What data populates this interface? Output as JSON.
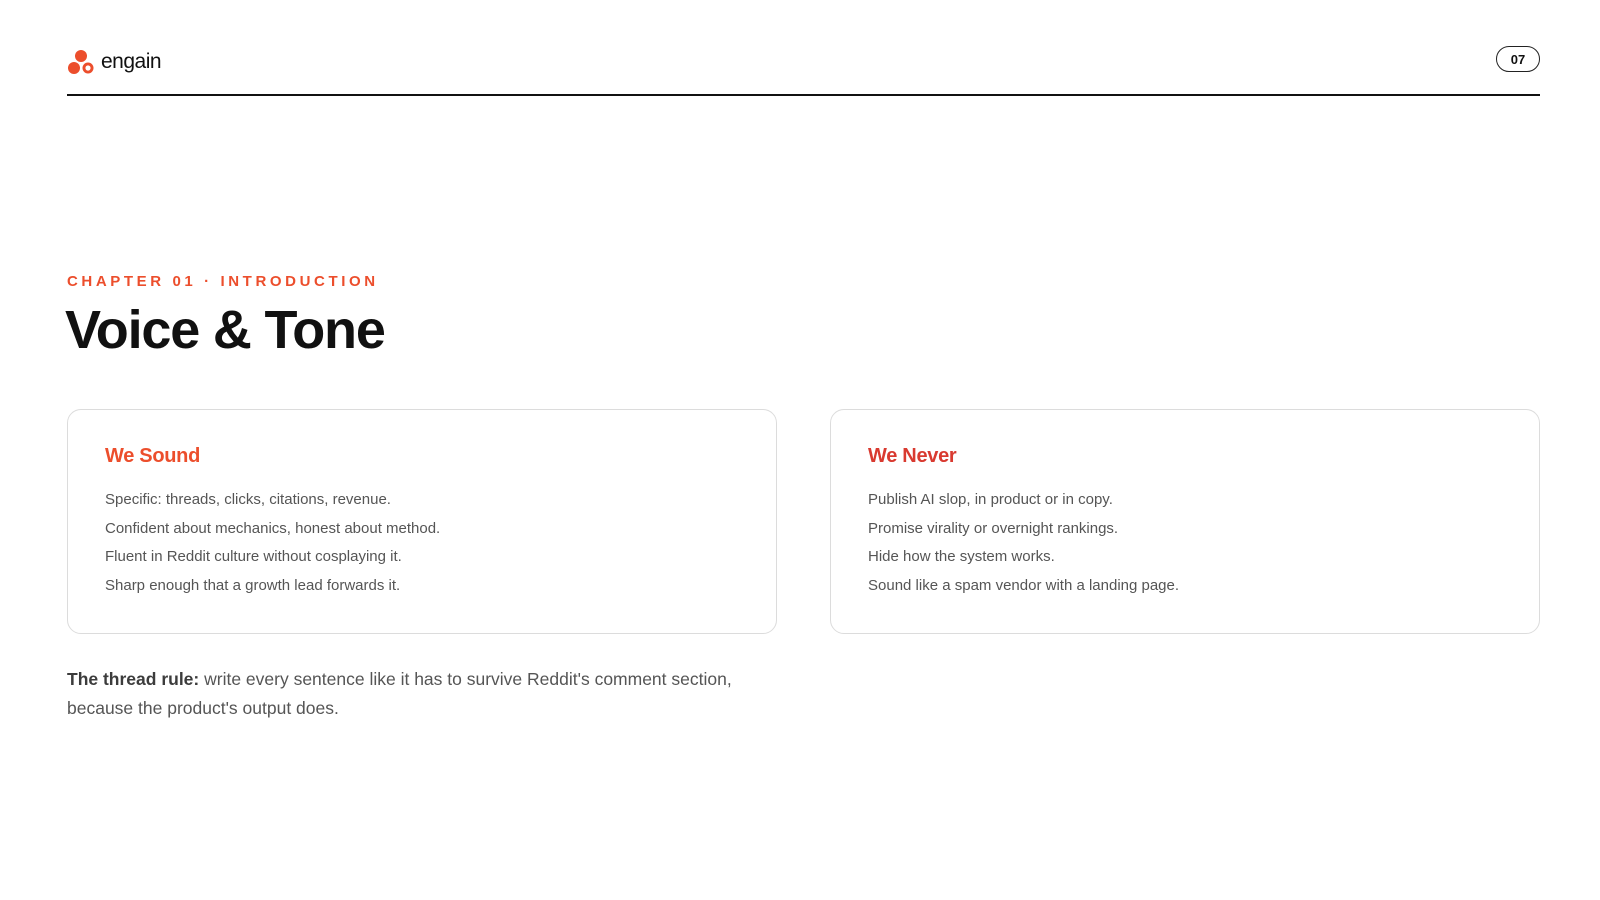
{
  "header": {
    "logo_text": "engain",
    "page_number": "07",
    "icon": "engain-logo-icon"
  },
  "hero": {
    "eyebrow": "CHAPTER 01 · INTRODUCTION",
    "title": "Voice & Tone"
  },
  "cards": [
    {
      "title": "We Sound",
      "items": [
        "Specific: threads, clicks, citations, revenue.",
        "Confident about mechanics, honest about method.",
        "Fluent in Reddit culture without cosplaying it.",
        "Sharp enough that a growth lead forwards it."
      ]
    },
    {
      "title": "We Never",
      "items": [
        "Publish AI slop, in product or in copy.",
        "Promise virality or overnight rankings.",
        "Hide how the system works.",
        "Sound like a spam vendor with a landing page."
      ]
    }
  ],
  "rule": {
    "label": "The thread rule:",
    "text": " write every sentence like it has to survive Reddit's comment section, because the product's output does."
  },
  "colors": {
    "accent": "#ec4e2c",
    "accent_red": "#d93a30",
    "text_dark": "#111111",
    "text_body": "#555555"
  }
}
